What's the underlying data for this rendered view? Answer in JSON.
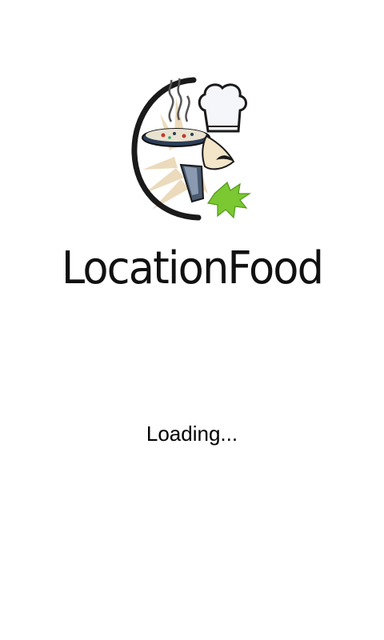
{
  "splash": {
    "logo_icon": "chef-pizza-logo-icon",
    "app_name": "LocationFood",
    "loading_text": "Loading..."
  },
  "colors": {
    "background": "#ffffff",
    "text": "#111111",
    "logo_outline": "#1a1a1a",
    "logo_beige": "#ead7b5",
    "logo_green": "#7cc832",
    "logo_slate": "#4a5a70"
  }
}
